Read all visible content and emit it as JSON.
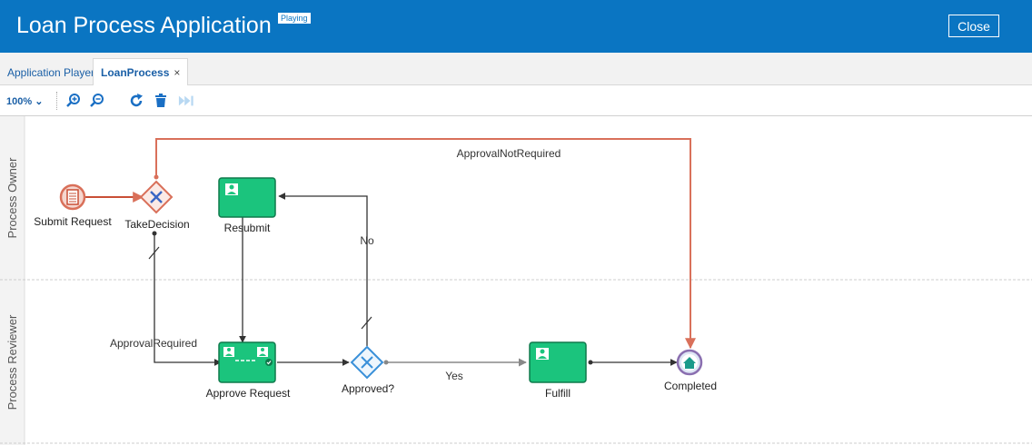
{
  "header": {
    "title": "Loan Process Application",
    "badge": "Playing",
    "close_label": "Close"
  },
  "tabs": [
    {
      "label": "Application Player"
    },
    {
      "label": "LoanProcess",
      "close": "×"
    }
  ],
  "toolbar": {
    "zoom": "100%"
  },
  "lanes": [
    {
      "label": "Process Owner"
    },
    {
      "label": "Process Reviewer"
    }
  ],
  "nodes": {
    "submit": "Submit Request",
    "take": "TakeDecision",
    "resubmit": "Resubmit",
    "approve": "Approve Request",
    "approved": "Approved?",
    "fulfill": "Fulfill",
    "completed": "Completed"
  },
  "flows": {
    "not_required": "ApprovalNotRequired",
    "required": "ApprovalRequired",
    "no": "No",
    "yes": "Yes"
  },
  "colors": {
    "header": "#0a75c2",
    "task": "#1bc47d",
    "active_flow": "#d9705a"
  }
}
